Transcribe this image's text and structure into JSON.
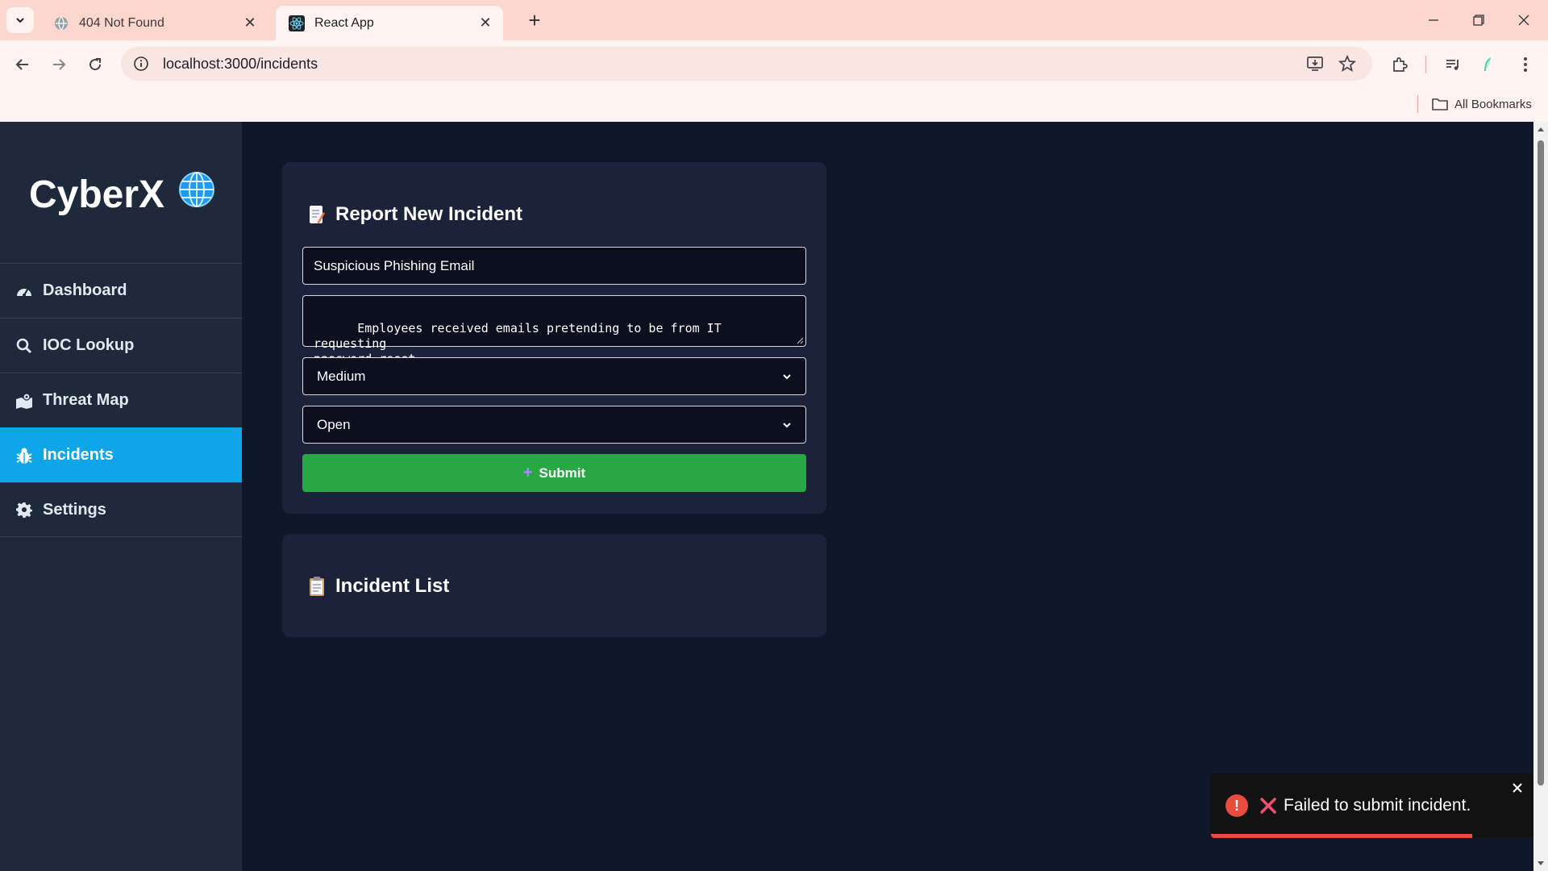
{
  "browser": {
    "tabs": [
      {
        "title": "404 Not Found",
        "favicon": "globe-icon",
        "active": false
      },
      {
        "title": "React App",
        "favicon": "react-icon",
        "active": true
      }
    ],
    "url": "localhost:3000/incidents",
    "bookmarks_label": "All Bookmarks"
  },
  "app": {
    "brand": "CyberX",
    "brand_icon": "🌐",
    "nav": [
      {
        "label": "Dashboard",
        "icon": "tachometer-icon",
        "active": false
      },
      {
        "label": "IOC Lookup",
        "icon": "search-icon",
        "active": false
      },
      {
        "label": "Threat Map",
        "icon": "map-icon",
        "active": false
      },
      {
        "label": "Incidents",
        "icon": "bug-icon",
        "active": true
      },
      {
        "label": "Settings",
        "icon": "gear-icon",
        "active": false
      }
    ],
    "form": {
      "title": "Report New Incident",
      "title_icon": "📝",
      "title_value": "Suspicious Phishing Email",
      "description_value": "Employees received emails pretending to be from IT requesting\npassword reset.",
      "severity_value": "Medium",
      "status_value": "Open",
      "submit_icon": "+",
      "submit_label": "Submit"
    },
    "list": {
      "title": "Incident List",
      "title_icon": "📋"
    },
    "toast": {
      "message": "Failed to submit incident.",
      "icon": "!",
      "progress": 0.81
    }
  },
  "colors": {
    "sidebar_bg": "#1e293b",
    "active_nav": "#0ea5e9",
    "submit_green": "#28a745",
    "error_red": "#e74c3c"
  }
}
